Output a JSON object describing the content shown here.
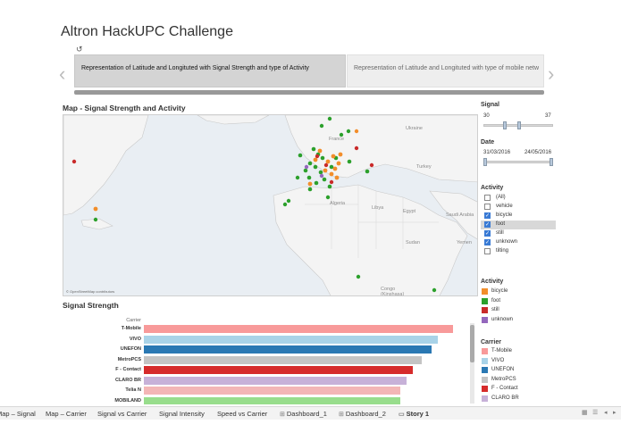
{
  "title": "Altron HackUPC Challenge",
  "revert_icon": "↺",
  "story": {
    "prev_arrow": "‹",
    "next_arrow": "›",
    "points": [
      "Representation of Latitude and Longituted with Signal Strength and type of Activity",
      "Representation of Latitude and Longituted with type of mobile netw"
    ]
  },
  "map_section": {
    "title": "Map -  Signal Strength and Activity",
    "credit": "© OpenStreetMap contributors",
    "labels": [
      "France",
      "Ukraine",
      "Turkey",
      "Algeria",
      "Libya",
      "Egypt",
      "Saudi Arabia",
      "Sudan",
      "Yemen",
      "Congo (Kinshasa)"
    ]
  },
  "signal_section": {
    "title": "Signal Strength",
    "column_header": "Carrier",
    "carriers": [
      {
        "name": "T-Mobile",
        "value": 100,
        "color": "#f89a9a"
      },
      {
        "name": "VIVO",
        "value": 95,
        "color": "#a9d3e8"
      },
      {
        "name": "UNEFON",
        "value": 93,
        "color": "#2a78b3"
      },
      {
        "name": "MetroPCS",
        "value": 90,
        "color": "#c4c4c4"
      },
      {
        "name": "F - Contact",
        "value": 87,
        "color": "#d62b2b"
      },
      {
        "name": "CLARO BR",
        "value": 85,
        "color": "#c7b1d8"
      },
      {
        "name": "Telia N",
        "value": 83,
        "color": "#f3b6b6"
      },
      {
        "name": "MOBILAND",
        "value": 83,
        "color": "#98dd8c"
      }
    ]
  },
  "filters": {
    "signal": {
      "title": "Signal",
      "min": "30",
      "max": "37",
      "low_frac": 0.3,
      "high_frac": 0.52
    },
    "date": {
      "title": "Date",
      "start": "31/03/2016",
      "end": "24/05/2016"
    },
    "activity": {
      "title": "Activity",
      "items": [
        {
          "label": "(All)",
          "checked": false
        },
        {
          "label": "vehicle",
          "checked": false
        },
        {
          "label": "bicycle",
          "checked": true
        },
        {
          "label": "foot",
          "checked": true
        },
        {
          "label": "still",
          "checked": true
        },
        {
          "label": "unknown",
          "checked": true
        },
        {
          "label": "tilting",
          "checked": false
        }
      ]
    }
  },
  "activity_legend": {
    "title": "Activity",
    "items": [
      {
        "label": "bicycle",
        "color": "#f28e2b"
      },
      {
        "label": "foot",
        "color": "#2ca02c"
      },
      {
        "label": "still",
        "color": "#c92a2a"
      },
      {
        "label": "unknown",
        "color": "#9467bd"
      }
    ]
  },
  "carrier_legend": {
    "title": "Carrier",
    "items": [
      {
        "label": "T-Mobile",
        "color": "#f89a9a"
      },
      {
        "label": "VIVO",
        "color": "#a9d3e8"
      },
      {
        "label": "UNEFON",
        "color": "#2a78b3"
      },
      {
        "label": "MetroPCS",
        "color": "#c4c4c4"
      },
      {
        "label": "F - Contact",
        "color": "#d62b2b"
      },
      {
        "label": "CLARO BR",
        "color": "#c7b1d8"
      }
    ]
  },
  "tabs": [
    {
      "label": "Map – Signal",
      "icon": ""
    },
    {
      "label": "Map – Carrier",
      "icon": ""
    },
    {
      "label": "Signal vs Carrier",
      "icon": ""
    },
    {
      "label": "Signal Intensity",
      "icon": ""
    },
    {
      "label": "Speed vs Carrier",
      "icon": ""
    },
    {
      "label": "Dashboard_1",
      "icon": "⊞"
    },
    {
      "label": "Dashboard_2",
      "icon": "⊞"
    },
    {
      "label": "Story 1",
      "icon": "▭",
      "active": true
    }
  ],
  "tab_controls": [
    "▦",
    "☰",
    "◂",
    "▸"
  ]
}
